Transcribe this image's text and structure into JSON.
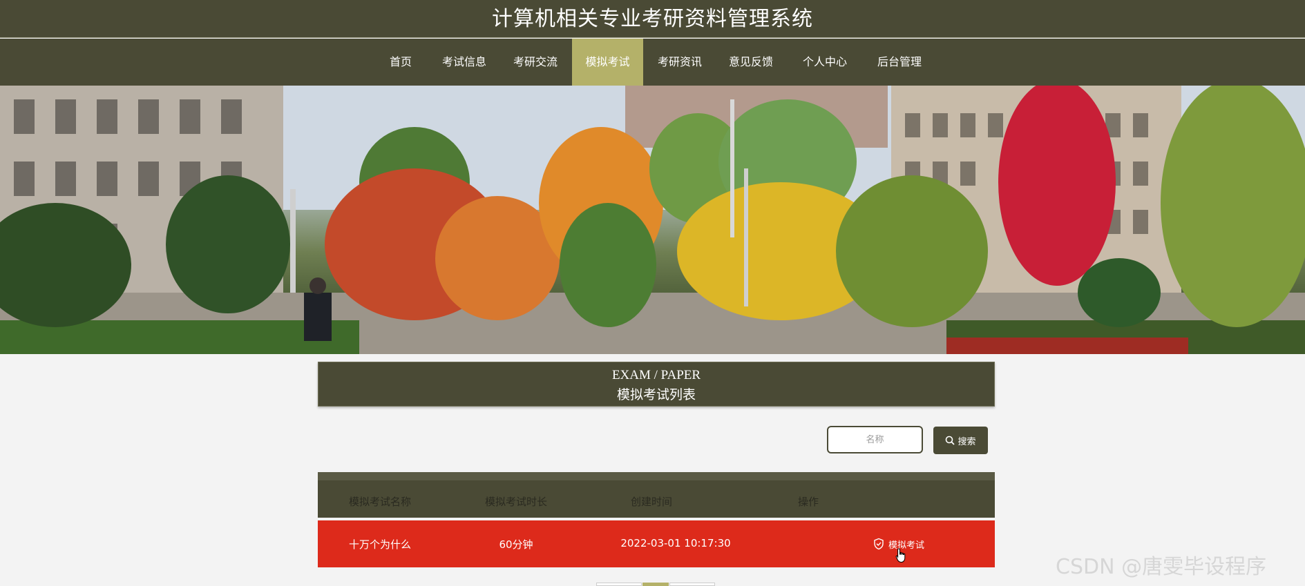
{
  "header": {
    "title": "计算机相关专业考研资料管理系统"
  },
  "nav": {
    "items": [
      {
        "label": "首页"
      },
      {
        "label": "考试信息"
      },
      {
        "label": "考研交流"
      },
      {
        "label": "模拟考试"
      },
      {
        "label": "考研资讯"
      },
      {
        "label": "意见反馈"
      },
      {
        "label": "个人中心"
      },
      {
        "label": "后台管理"
      }
    ],
    "active": "模拟考试"
  },
  "section": {
    "title_en": "EXAM / PAPER",
    "title_cn": "模拟考试列表"
  },
  "search": {
    "placeholder": "名称",
    "button_label": "搜索"
  },
  "table": {
    "headers": [
      "模拟考试名称",
      "模拟考试时长",
      "创建时间",
      "操作"
    ],
    "rows": [
      {
        "name": "十万个为什么",
        "duration": "60分钟",
        "created": "2022-03-01 10:17:30",
        "action": "模拟考试"
      }
    ]
  },
  "watermark": "CSDN @唐雯毕设程序",
  "colors": {
    "header_bg": "#4a4a35",
    "active_nav": "#b4b169",
    "row_highlight": "#dd2a1b"
  }
}
